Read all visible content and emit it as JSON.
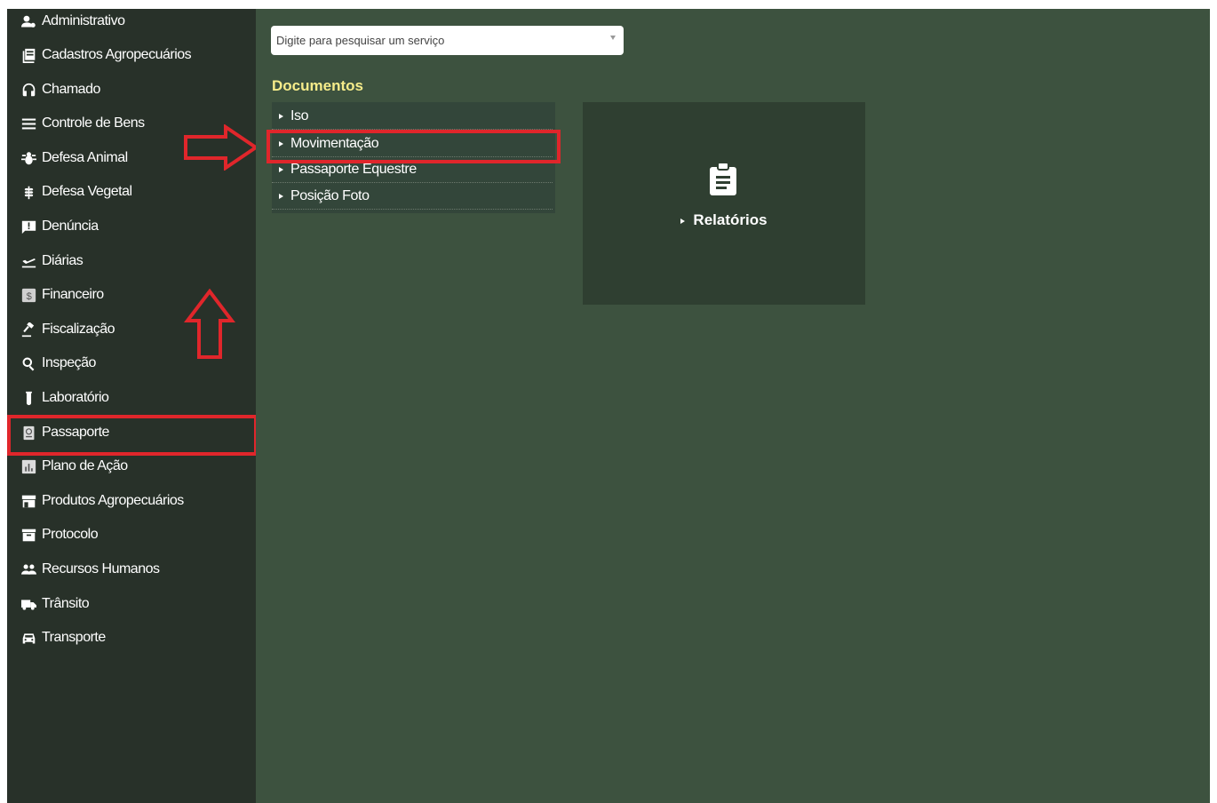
{
  "sidebar": {
    "items": [
      {
        "label": "Administrativo",
        "icon": "user-cog-icon"
      },
      {
        "label": "Cadastros Agropecuários",
        "icon": "book-icon"
      },
      {
        "label": "Chamado",
        "icon": "headset-icon"
      },
      {
        "label": "Controle de Bens",
        "icon": "list-icon"
      },
      {
        "label": "Defesa Animal",
        "icon": "bug-icon"
      },
      {
        "label": "Defesa Vegetal",
        "icon": "wheat-icon"
      },
      {
        "label": "Denúncia",
        "icon": "report-flag-icon"
      },
      {
        "label": "Diárias",
        "icon": "airplane-icon"
      },
      {
        "label": "Financeiro",
        "icon": "dollar-icon"
      },
      {
        "label": "Fiscalização",
        "icon": "gavel-icon"
      },
      {
        "label": "Inspeção",
        "icon": "magnifier-icon"
      },
      {
        "label": "Laboratório",
        "icon": "test-tube-icon"
      },
      {
        "label": "Passaporte",
        "icon": "passport-icon"
      },
      {
        "label": "Plano de Ação",
        "icon": "bar-chart-icon"
      },
      {
        "label": "Produtos Agropecuários",
        "icon": "store-icon"
      },
      {
        "label": "Protocolo",
        "icon": "archive-icon"
      },
      {
        "label": "Recursos Humanos",
        "icon": "people-icon"
      },
      {
        "label": "Trânsito",
        "icon": "truck-icon"
      },
      {
        "label": "Transporte",
        "icon": "car-icon"
      }
    ],
    "highlighted": "Passaporte"
  },
  "search": {
    "placeholder": "Digite para pesquisar um serviço"
  },
  "main": {
    "section_title": "Documentos",
    "documents": [
      {
        "label": "Iso"
      },
      {
        "label": "Movimentação"
      },
      {
        "label": "Passaporte Equestre"
      },
      {
        "label": "Posição Foto"
      }
    ],
    "highlighted_document": "Movimentação",
    "reports_card": {
      "label": "Relatórios",
      "icon": "clipboard-icon"
    }
  },
  "colors": {
    "sidebar_bg": "#283129",
    "main_bg": "#3d523f",
    "section_title": "#f6ec8a",
    "annotation_red": "#e0262b"
  }
}
